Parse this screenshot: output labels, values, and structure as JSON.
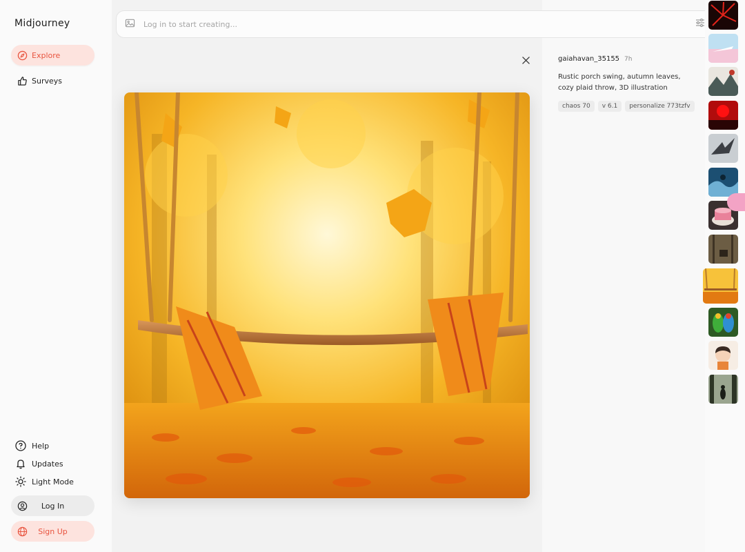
{
  "app": {
    "brand": "Midjourney"
  },
  "sidebar": {
    "items": [
      {
        "label": "Explore",
        "icon": "compass-icon",
        "active": true
      },
      {
        "label": "Surveys",
        "icon": "thumbs-up-icon",
        "active": false
      }
    ],
    "bottom_links": [
      {
        "label": "Help",
        "icon": "help-circle-icon"
      },
      {
        "label": "Updates",
        "icon": "bell-icon"
      },
      {
        "label": "Light Mode",
        "icon": "sun-icon"
      }
    ],
    "login_label": "Log In",
    "signup_label": "Sign Up"
  },
  "search": {
    "placeholder": "Log in to start creating..."
  },
  "details": {
    "username": "gaiahavan_35155",
    "time": "7h",
    "prompt": "Rustic porch swing, autumn leaves, cozy plaid throw, 3D illustration",
    "tags": [
      "chaos 70",
      "v 6.1",
      "personalize 773tzfv"
    ]
  },
  "colors": {
    "accent": "#e8543f",
    "accent_bg": "#fde3de"
  },
  "thumbnails": [
    {
      "name": "thumb-red-fireworks"
    },
    {
      "name": "thumb-pastel-sky"
    },
    {
      "name": "thumb-ink-landscape"
    },
    {
      "name": "thumb-red-sun"
    },
    {
      "name": "thumb-winged-creature"
    },
    {
      "name": "thumb-ocean-wave"
    },
    {
      "name": "thumb-cake"
    },
    {
      "name": "thumb-deer-forest"
    },
    {
      "name": "thumb-autumn-swing",
      "selected": true
    },
    {
      "name": "thumb-parrots"
    },
    {
      "name": "thumb-cartoon-girl"
    },
    {
      "name": "thumb-forest-figure"
    }
  ]
}
